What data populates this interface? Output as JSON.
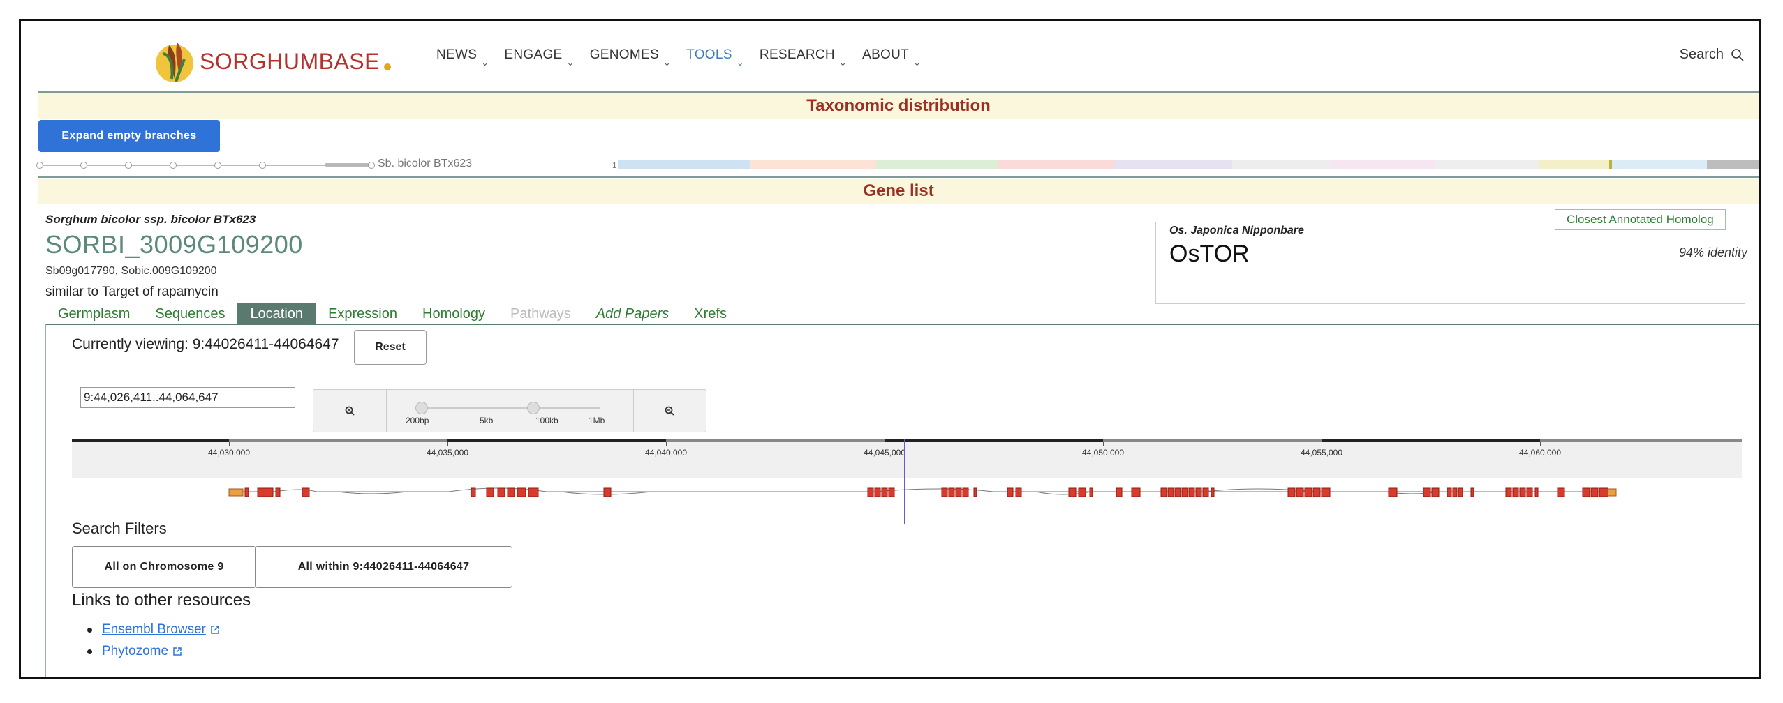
{
  "header": {
    "logo_text": "SORGHUMBASE",
    "nav": [
      {
        "label": "NEWS",
        "active": false
      },
      {
        "label": "ENGAGE",
        "active": false
      },
      {
        "label": "GENOMES",
        "active": false
      },
      {
        "label": "TOOLS",
        "active": true
      },
      {
        "label": "RESEARCH",
        "active": false
      },
      {
        "label": "ABOUT",
        "active": false
      }
    ],
    "search_label": "Search",
    "caret": "⌄"
  },
  "taxonomy": {
    "title": "Taxonomic distribution",
    "expand_button": "Expand empty branches",
    "species_label": "Sb. bicolor BTx623",
    "count": "1"
  },
  "gene_list": {
    "title": "Gene list",
    "species": "Sorghum bicolor ssp. bicolor BTx623",
    "gene_id": "SORBI_3009G109200",
    "synonyms": "Sb09g017790, Sobic.009G109200",
    "description": "similar to Target of rapamycin"
  },
  "homolog": {
    "tag": "Closest Annotated Homolog",
    "species": "Os. Japonica Nipponbare",
    "name": "OsTOR",
    "identity": "94% identity"
  },
  "tabs": [
    {
      "label": "Germplasm",
      "state": "normal"
    },
    {
      "label": "Sequences",
      "state": "normal"
    },
    {
      "label": "Location",
      "state": "active"
    },
    {
      "label": "Expression",
      "state": "normal"
    },
    {
      "label": "Homology",
      "state": "normal"
    },
    {
      "label": "Pathways",
      "state": "disabled"
    },
    {
      "label": "Add Papers",
      "state": "italic"
    },
    {
      "label": "Xrefs",
      "state": "normal"
    }
  ],
  "location": {
    "viewing_label": "Currently viewing: 9:44026411-44064647",
    "reset_button": "Reset",
    "input_value": "9:44,026,411..44,064,647",
    "zoom_labels": [
      "200bp",
      "5kb",
      "100kb",
      "1Mb"
    ],
    "ruler_labels": [
      "44,030,000",
      "44,035,000",
      "44,040,000",
      "44,045,000",
      "44,050,000",
      "44,055,000",
      "44,060,000"
    ]
  },
  "filters": {
    "title": "Search Filters",
    "buttons": [
      "All on Chromosome 9",
      "All within 9:44026411-44064647"
    ]
  },
  "links": {
    "title": "Links to other resources",
    "items": [
      "Ensembl Browser",
      "Phytozome"
    ]
  },
  "colors": {
    "brand_red": "#b5322c",
    "accent_blue": "#2f72d8",
    "tab_green": "#2e7d32",
    "exon_red": "#d93a2b",
    "utr_orange": "#e8a040"
  }
}
